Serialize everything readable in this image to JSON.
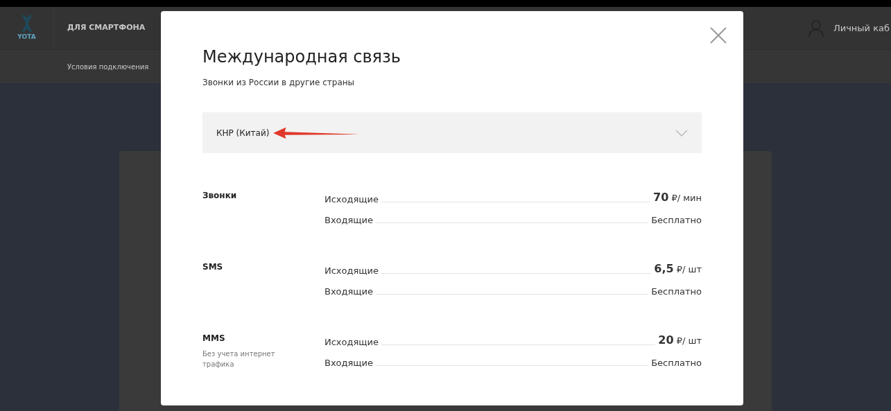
{
  "header": {
    "logo": "YOTA",
    "nav_item": "ДЛЯ СМАРТФОНА",
    "account": "Личный каб",
    "subnav_item": "Условия подключения"
  },
  "modal": {
    "title": "Международная связь",
    "subtitle": "Звонки из России в другие страны",
    "country_select": {
      "value": "КНР (Китай)"
    },
    "sections": [
      {
        "name": "Звонки",
        "rows": [
          {
            "label": "Исходящие",
            "kind": "price",
            "amount": "70",
            "unit": "₽/ мин"
          },
          {
            "label": "Входящие",
            "kind": "text",
            "value": "Бесплатно"
          }
        ]
      },
      {
        "name": "SMS",
        "rows": [
          {
            "label": "Исходящие",
            "kind": "price",
            "amount": "6,5",
            "unit": "₽/ шт"
          },
          {
            "label": "Входящие",
            "kind": "text",
            "value": "Бесплатно"
          }
        ]
      },
      {
        "name": "MMS",
        "note": "Без учета интернет трафика",
        "rows": [
          {
            "label": "Исходящие",
            "kind": "price",
            "amount": "20",
            "unit": "₽/ шт"
          },
          {
            "label": "Входящие",
            "kind": "text",
            "value": "Бесплатно"
          }
        ]
      }
    ]
  }
}
